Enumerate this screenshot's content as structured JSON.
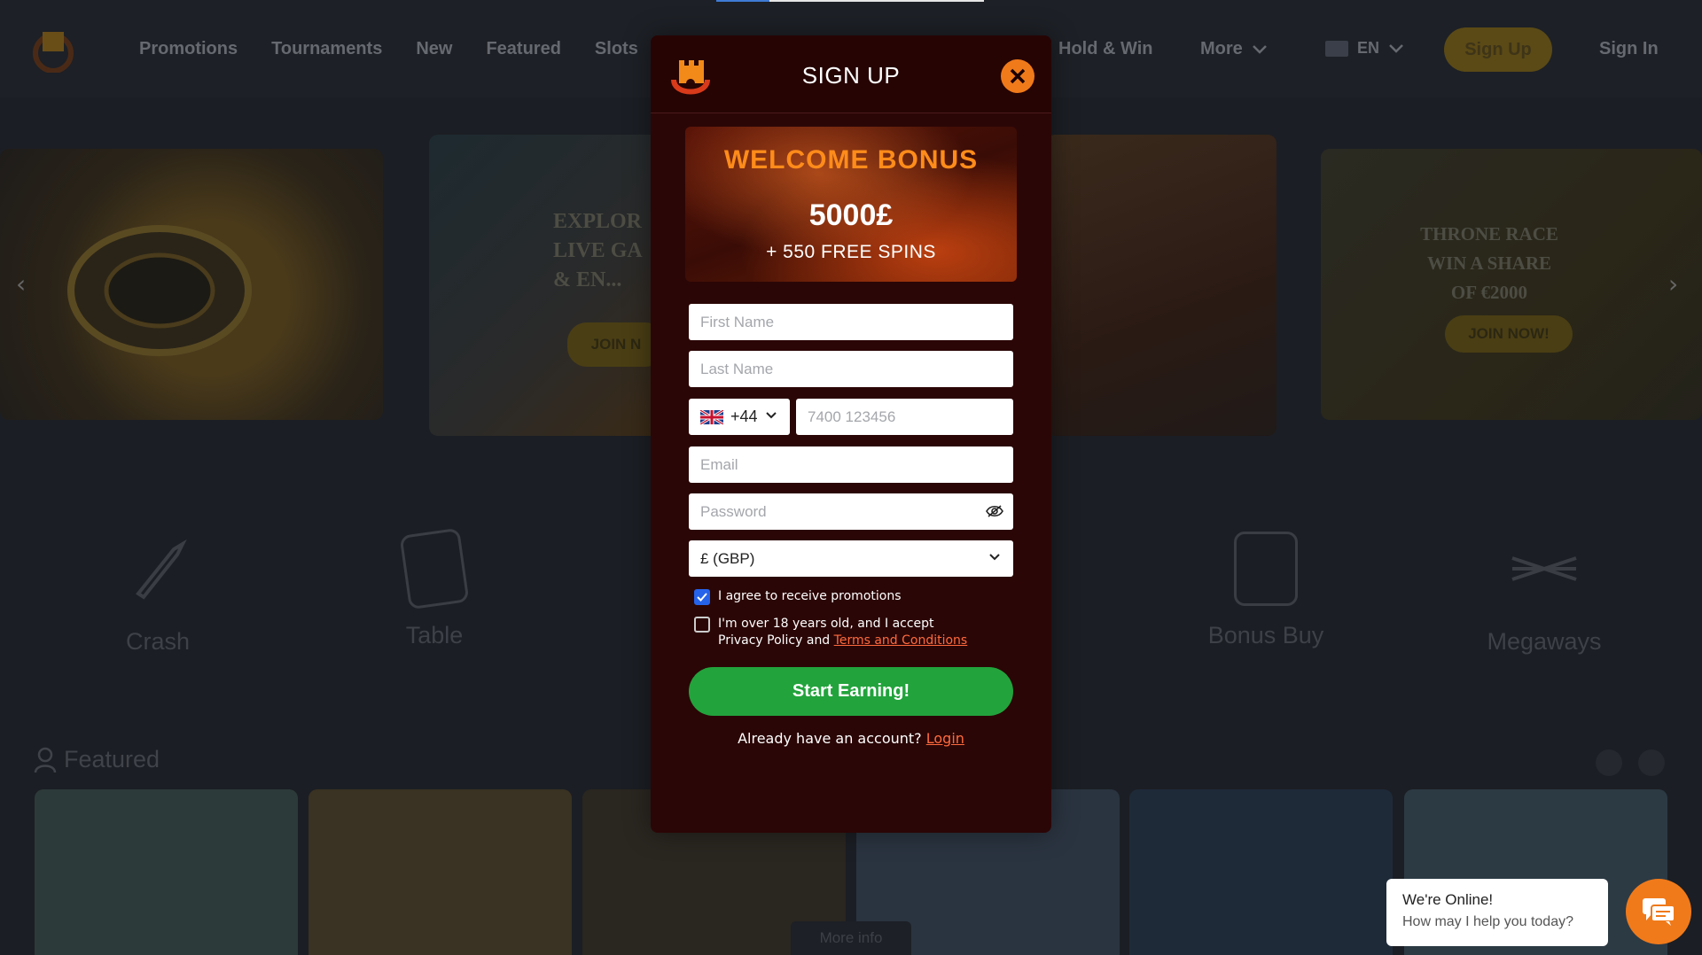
{
  "header": {
    "nav": [
      "Promotions",
      "Tournaments",
      "New",
      "Featured",
      "Slots"
    ],
    "nav_right": [
      "Hold & Win",
      "More"
    ],
    "lang": "EN",
    "signup": "Sign Up",
    "signin": "Sign In"
  },
  "banners": {
    "b2_lines": [
      "EXPLOR",
      "LIVE GA",
      "& EN..."
    ],
    "b2_button": "JOIN N",
    "b4_lines": [
      "THRONE RACE",
      "WIN A SHARE",
      "OF €2000"
    ],
    "b4_button": "JOIN NOW!"
  },
  "categories": [
    "Crash",
    "Table",
    "Bonus Buy",
    "Megaways"
  ],
  "featured": {
    "title": "Featured",
    "more_info": "More info"
  },
  "modal": {
    "title": "SIGN UP",
    "bonus_title": "WELCOME BONUS",
    "bonus_amount": "5000£",
    "bonus_spins": "+ 550 FREE SPINS",
    "first_name_placeholder": "First Name",
    "last_name_placeholder": "Last Name",
    "phone_code": "+44",
    "phone_placeholder": "7400 123456",
    "email_placeholder": "Email",
    "password_placeholder": "Password",
    "currency": "£ (GBP)",
    "promo_label": "I agree to receive promotions",
    "age_label_1": "I'm over 18 years old, and I accept",
    "age_label_2": "Privacy Policy and ",
    "terms_link": "Terms and Conditions",
    "submit": "Start Earning!",
    "already_text": "Already have an account? ",
    "login_link": "Login"
  },
  "chat": {
    "title": "We're Online!",
    "subtitle": "How may I help you today?"
  },
  "colors": {
    "accent": "#f07a1a",
    "modal_bg": "#2b0606",
    "submit_green": "#22a33c",
    "bonus_orange": "#ff8c1a",
    "link": "#ff6a3d"
  }
}
